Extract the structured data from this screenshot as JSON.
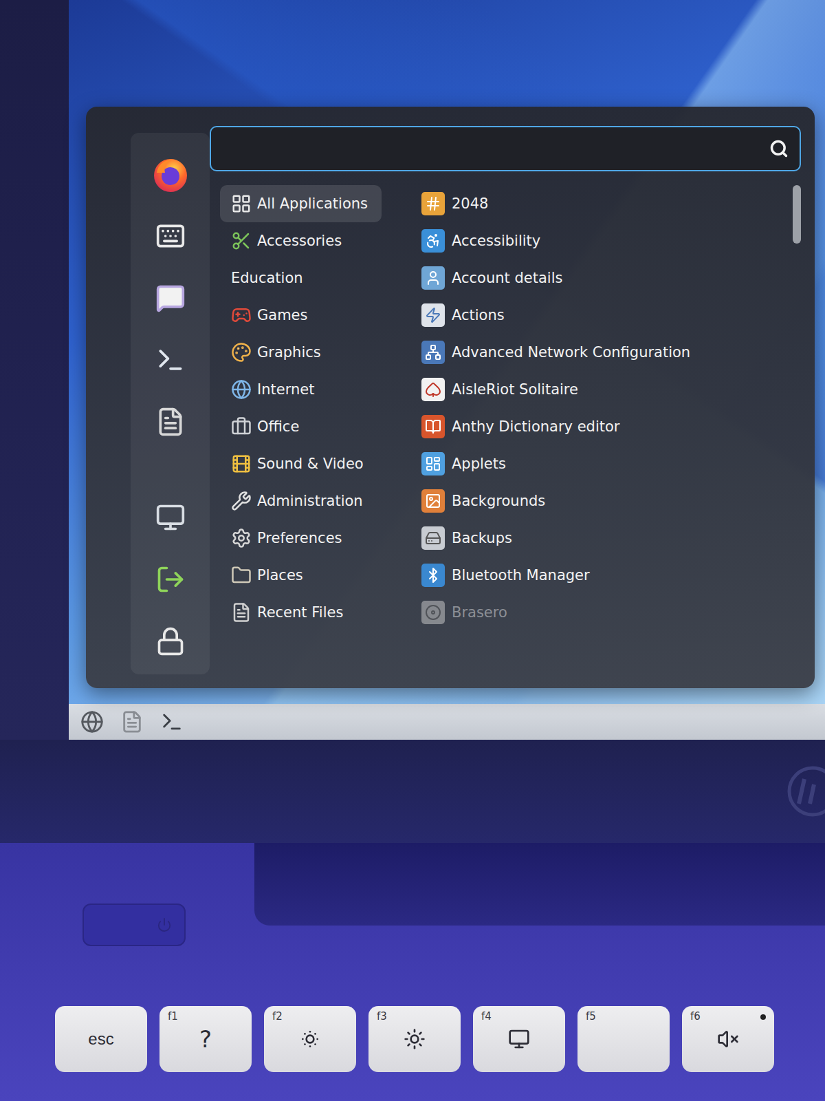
{
  "menu": {
    "search": {
      "placeholder": "",
      "focused": true
    },
    "favorites": [
      {
        "kind": "firefox"
      },
      {
        "kind": "settings"
      },
      {
        "kind": "chat"
      },
      {
        "kind": "terminal"
      },
      {
        "kind": "files"
      }
    ],
    "session": [
      {
        "kind": "screensaver"
      },
      {
        "kind": "logout"
      },
      {
        "kind": "lock"
      }
    ],
    "categories": [
      {
        "label": "All Applications",
        "selected": true,
        "has_icon": true
      },
      {
        "label": "Accessories",
        "selected": false,
        "has_icon": true
      },
      {
        "label": "Education",
        "selected": false,
        "has_icon": false
      },
      {
        "label": "Games",
        "selected": false,
        "has_icon": true
      },
      {
        "label": "Graphics",
        "selected": false,
        "has_icon": true
      },
      {
        "label": "Internet",
        "selected": false,
        "has_icon": true
      },
      {
        "label": "Office",
        "selected": false,
        "has_icon": true
      },
      {
        "label": "Sound & Video",
        "selected": false,
        "has_icon": true
      },
      {
        "label": "Administration",
        "selected": false,
        "has_icon": true
      },
      {
        "label": "Preferences",
        "selected": false,
        "has_icon": true
      },
      {
        "label": "Places",
        "selected": false,
        "has_icon": true
      },
      {
        "label": "Recent Files",
        "selected": false,
        "has_icon": true
      }
    ],
    "apps": [
      {
        "label": "2048",
        "dimmed": false
      },
      {
        "label": "Accessibility",
        "dimmed": false
      },
      {
        "label": "Account details",
        "dimmed": false
      },
      {
        "label": "Actions",
        "dimmed": false
      },
      {
        "label": "Advanced Network Configuration",
        "dimmed": false
      },
      {
        "label": "AisleRiot Solitaire",
        "dimmed": false
      },
      {
        "label": "Anthy Dictionary editor",
        "dimmed": false
      },
      {
        "label": "Applets",
        "dimmed": false
      },
      {
        "label": "Backgrounds",
        "dimmed": false
      },
      {
        "label": "Backups",
        "dimmed": false
      },
      {
        "label": "Bluetooth Manager",
        "dimmed": false
      },
      {
        "label": "Brasero",
        "dimmed": true
      }
    ],
    "scrollbar": {
      "level": 0.12
    }
  },
  "taskbar": {
    "items": [
      {
        "kind": "menu"
      },
      {
        "kind": "files"
      },
      {
        "kind": "terminal"
      }
    ]
  },
  "keyboard": {
    "keys": [
      {
        "fn": "",
        "kind": "text",
        "symbol": "esc"
      },
      {
        "fn": "f1",
        "kind": "text",
        "symbol": "?"
      },
      {
        "fn": "f2",
        "kind": "brightness-down"
      },
      {
        "fn": "f3",
        "kind": "brightness-up"
      },
      {
        "fn": "f4",
        "kind": "display"
      },
      {
        "fn": "f5",
        "kind": "blank"
      },
      {
        "fn": "f6",
        "kind": "mute",
        "led": false
      }
    ]
  }
}
